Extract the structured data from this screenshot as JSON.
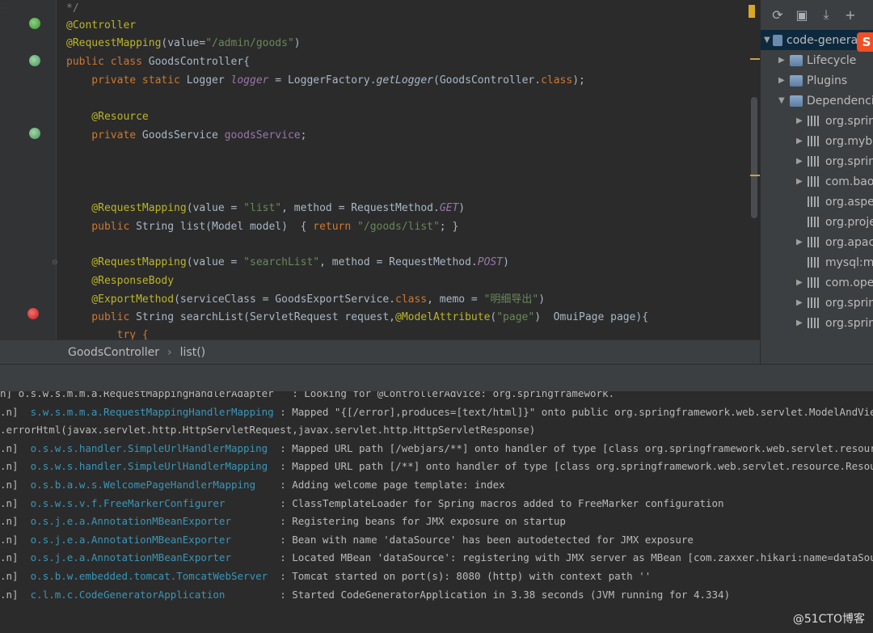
{
  "editor": {
    "lines": [
      {
        "parts": [
          {
            "t": "*/",
            "c": "cmt"
          }
        ]
      },
      {
        "parts": [
          {
            "t": "@Controller",
            "c": "ann"
          }
        ]
      },
      {
        "parts": [
          {
            "t": "@RequestMapping",
            "c": "ann"
          },
          {
            "t": "(value=",
            "c": ""
          },
          {
            "t": "\"/admin/goods\"",
            "c": "str"
          },
          {
            "t": ")",
            "c": ""
          }
        ]
      },
      {
        "parts": [
          {
            "t": "public class ",
            "c": "kw"
          },
          {
            "t": "GoodsController{",
            "c": ""
          }
        ]
      },
      {
        "parts": [
          {
            "t": "    private static ",
            "c": "kw"
          },
          {
            "t": "Logger ",
            "c": ""
          },
          {
            "t": "logger",
            "c": "fld ital"
          },
          {
            "t": " = LoggerFactory.",
            "c": ""
          },
          {
            "t": "getLogger",
            "c": "ital"
          },
          {
            "t": "(GoodsController.",
            "c": ""
          },
          {
            "t": "class",
            "c": "kw"
          },
          {
            "t": ");",
            "c": ""
          }
        ]
      },
      {
        "parts": []
      },
      {
        "parts": [
          {
            "t": "    @Resource",
            "c": "ann"
          }
        ]
      },
      {
        "parts": [
          {
            "t": "    private ",
            "c": "kw"
          },
          {
            "t": "GoodsService ",
            "c": ""
          },
          {
            "t": "goodsService",
            "c": "fld"
          },
          {
            "t": ";",
            "c": ""
          }
        ]
      },
      {
        "parts": []
      },
      {
        "parts": []
      },
      {
        "parts": []
      },
      {
        "parts": [
          {
            "t": "    @RequestMapping",
            "c": "ann"
          },
          {
            "t": "(value = ",
            "c": ""
          },
          {
            "t": "\"list\"",
            "c": "str"
          },
          {
            "t": ", method = RequestMethod.",
            "c": ""
          },
          {
            "t": "GET",
            "c": "fld ital"
          },
          {
            "t": ")",
            "c": ""
          }
        ]
      },
      {
        "parts": [
          {
            "t": "    public ",
            "c": "kw"
          },
          {
            "t": "String list(Model model)  { ",
            "c": ""
          },
          {
            "t": "return ",
            "c": "kw"
          },
          {
            "t": "\"/goods/list\"",
            "c": "str"
          },
          {
            "t": "; }",
            "c": ""
          }
        ]
      },
      {
        "parts": []
      },
      {
        "parts": [
          {
            "t": "    @RequestMapping",
            "c": "ann"
          },
          {
            "t": "(value = ",
            "c": ""
          },
          {
            "t": "\"searchList\"",
            "c": "str"
          },
          {
            "t": ", method = RequestMethod.",
            "c": ""
          },
          {
            "t": "POST",
            "c": "fld ital"
          },
          {
            "t": ")",
            "c": ""
          }
        ]
      },
      {
        "parts": [
          {
            "t": "    @ResponseBody",
            "c": "ann"
          }
        ]
      },
      {
        "parts": [
          {
            "t": "    @ExportMethod",
            "c": "ann"
          },
          {
            "t": "(serviceClass = GoodsExportService.",
            "c": ""
          },
          {
            "t": "class",
            "c": "kw"
          },
          {
            "t": ", memo = ",
            "c": ""
          },
          {
            "t": "\"明细导出\"",
            "c": "str"
          },
          {
            "t": ")",
            "c": ""
          }
        ]
      },
      {
        "parts": [
          {
            "t": "    public ",
            "c": "kw"
          },
          {
            "t": "String searchList(ServletRequest request,",
            "c": ""
          },
          {
            "t": "@ModelAttribute",
            "c": "ann"
          },
          {
            "t": "(",
            "c": ""
          },
          {
            "t": "\"page\"",
            "c": "str"
          },
          {
            "t": ")  OmuiPage page){",
            "c": ""
          }
        ]
      },
      {
        "parts": [
          {
            "t": "        try {",
            "c": "kw"
          }
        ]
      }
    ]
  },
  "breadcrumb": {
    "class_name": "GoodsController",
    "method_name": "list()"
  },
  "maven": {
    "toolbar": [
      {
        "name": "reimport-icon",
        "glyph": "⟳"
      },
      {
        "name": "generate-sources-icon",
        "glyph": "▣"
      },
      {
        "name": "download-icon",
        "glyph": "⤓"
      },
      {
        "name": "add-icon",
        "glyph": "+"
      }
    ],
    "root": "code-generator",
    "badge": "S",
    "items": [
      {
        "label": "Lifecycle",
        "level": 1,
        "arrow": "▶",
        "icon": "folder"
      },
      {
        "label": "Plugins",
        "level": 1,
        "arrow": "▶",
        "icon": "folder"
      },
      {
        "label": "Dependencies",
        "level": 1,
        "arrow": "▼",
        "icon": "folder"
      },
      {
        "label": "org.springframework",
        "level": 2,
        "arrow": "▶",
        "icon": "lib"
      },
      {
        "label": "org.mybatis",
        "level": 2,
        "arrow": "▶",
        "icon": "lib"
      },
      {
        "label": "org.springframework",
        "level": 2,
        "arrow": "▶",
        "icon": "lib"
      },
      {
        "label": "com.baomidou",
        "level": 2,
        "arrow": "▶",
        "icon": "lib"
      },
      {
        "label": "org.aspectj",
        "level": 2,
        "arrow": "",
        "icon": "lib"
      },
      {
        "label": "org.projectlombok",
        "level": 2,
        "arrow": "",
        "icon": "lib"
      },
      {
        "label": "org.apache",
        "level": 2,
        "arrow": "▶",
        "icon": "lib"
      },
      {
        "label": "mysql:mysql",
        "level": 2,
        "arrow": "",
        "icon": "lib"
      },
      {
        "label": "com.opencsv",
        "level": 2,
        "arrow": "▶",
        "icon": "lib"
      },
      {
        "label": "org.springframework",
        "level": 2,
        "arrow": "▶",
        "icon": "lib"
      },
      {
        "label": "org.springframework",
        "level": 2,
        "arrow": "▶",
        "icon": "lib"
      }
    ]
  },
  "console": {
    "lines": [
      {
        "prefix": "",
        "logger": "",
        "msg": "n] o.s.w.s.m.m.a.RequestMappingHandlerAdapter   : Looking for @ControllerAdvice: org.springframework."
      },
      {
        "prefix": ".n]",
        "logger": "s.w.s.m.m.a.RequestMappingHandlerMapping",
        "msg": " : Mapped \"{[/error],produces=[text/html]}\" onto public org.springframework.web.servlet.ModelAndView"
      },
      {
        "prefix": ".errorHtml(javax.servlet.http.HttpServletRequest,javax.servlet.http.HttpServletResponse)",
        "logger": "",
        "msg": ""
      },
      {
        "prefix": ".n]",
        "logger": "o.s.w.s.handler.SimpleUrlHandlerMapping",
        "msg": "  : Mapped URL path [/webjars/**] onto handler of type [class org.springframework.web.servlet.resource"
      },
      {
        "prefix": ".n]",
        "logger": "o.s.w.s.handler.SimpleUrlHandlerMapping",
        "msg": "  : Mapped URL path [/**] onto handler of type [class org.springframework.web.servlet.resource.Resource"
      },
      {
        "prefix": ".n]",
        "logger": "o.s.b.a.w.s.WelcomePageHandlerMapping",
        "msg": "    : Adding welcome page template: index"
      },
      {
        "prefix": ".n]",
        "logger": "o.s.w.s.v.f.FreeMarkerConfigurer",
        "msg": "         : ClassTemplateLoader for Spring macros added to FreeMarker configuration"
      },
      {
        "prefix": ".n]",
        "logger": "o.s.j.e.a.AnnotationMBeanExporter",
        "msg": "        : Registering beans for JMX exposure on startup"
      },
      {
        "prefix": ".n]",
        "logger": "o.s.j.e.a.AnnotationMBeanExporter",
        "msg": "        : Bean with name 'dataSource' has been autodetected for JMX exposure"
      },
      {
        "prefix": ".n]",
        "logger": "o.s.j.e.a.AnnotationMBeanExporter",
        "msg": "        : Located MBean 'dataSource': registering with JMX server as MBean [com.zaxxer.hikari:name=dataSou"
      },
      {
        "prefix": ".n]",
        "logger": "o.s.b.w.embedded.tomcat.TomcatWebServer",
        "msg": "  : Tomcat started on port(s): 8080 (http) with context path ''"
      },
      {
        "prefix": ".n]",
        "logger": "c.l.m.c.CodeGeneratorApplication",
        "msg": "         : Started CodeGeneratorApplication in 3.38 seconds (JVM running for 4.334)"
      }
    ]
  },
  "watermark": "@51CTO博客"
}
